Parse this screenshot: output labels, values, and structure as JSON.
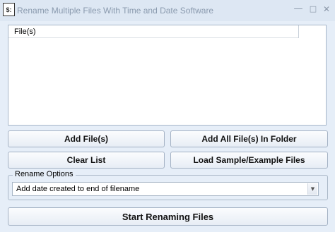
{
  "window": {
    "title": "Rename Multiple Files With Time and Date Software",
    "controls": {
      "minimize": "—",
      "maximize": "□",
      "close": "✕"
    }
  },
  "file_list": {
    "columns": [
      "File(s)"
    ],
    "rows": []
  },
  "buttons": {
    "add_files": "Add File(s)",
    "add_all_folder": "Add All File(s) In Folder",
    "clear_list": "Clear List",
    "load_sample": "Load Sample/Example Files",
    "start": "Start Renaming Files"
  },
  "rename_options": {
    "group_label": "Rename Options",
    "selected": "Add date created to end of filename"
  },
  "icons": {
    "app": "app-file-icon",
    "dropdown": "chevron-down-icon"
  }
}
